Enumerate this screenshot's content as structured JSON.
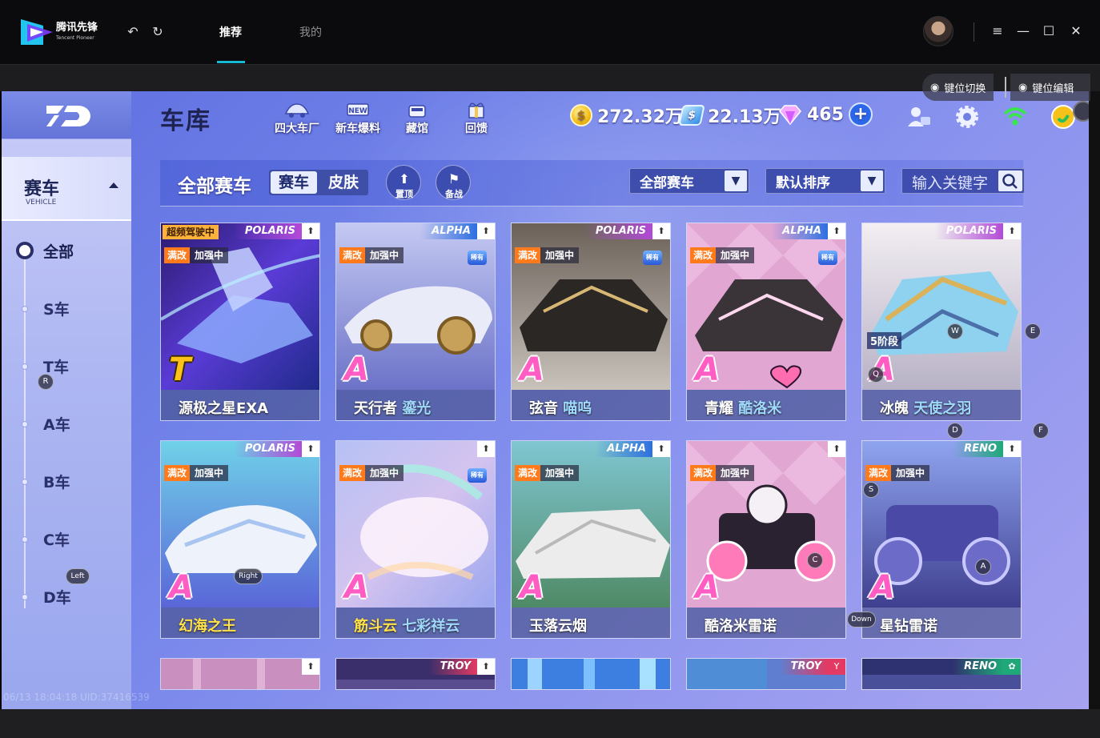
{
  "launcher": {
    "brand": "腾讯先锋",
    "brand_sub": "Tencent Pioneer",
    "tabs": [
      {
        "label": "推荐",
        "active": true
      },
      {
        "label": "我的",
        "active": false
      }
    ],
    "accent_color": "#17b8d6"
  },
  "overlay": {
    "key_switch": "键位切换",
    "key_edit": "键位编辑",
    "watermark": "06/13 18:04:18 UID:37416539",
    "keys": [
      "R",
      "E",
      "W",
      "Q",
      "D",
      "F",
      "S",
      "Right",
      "Left",
      "C",
      "A",
      "Down"
    ]
  },
  "game": {
    "title": "车库",
    "nav": [
      {
        "label": "四大车厂",
        "icon": "garage-car-icon"
      },
      {
        "label": "新车爆料",
        "icon": "new-badge-icon"
      },
      {
        "label": "藏馆",
        "icon": "museum-icon"
      },
      {
        "label": "回馈",
        "icon": "gift-icon"
      }
    ],
    "currency": {
      "coins": "272.32万",
      "vouchers": "22.13万",
      "diamonds": "465"
    },
    "sidebar": {
      "category": "赛车",
      "category_sub": "VEHICLE",
      "items": [
        "全部",
        "S车",
        "T车",
        "A车",
        "B车",
        "C车",
        "D车"
      ],
      "active_index": 0
    },
    "filter": {
      "title": "全部赛车",
      "segment": [
        "赛车",
        "皮肤"
      ],
      "pin_label": "置顶",
      "battle_label": "备战",
      "dropdown_type": "全部赛车",
      "dropdown_sort": "默认排序",
      "search_placeholder": "输入关键字"
    },
    "tags": {
      "maxed": "满改",
      "boosted": "加强中",
      "frequent": "超频驾驶中",
      "rare": "稀有"
    },
    "cards_row1": [
      {
        "series": "POLARIS",
        "name": "源极之星EXA",
        "skin": "",
        "grade": "T",
        "hot": true
      },
      {
        "series": "ALPHA",
        "name": "天行者",
        "skin": "鎏光",
        "grade": "A",
        "hot": false
      },
      {
        "series": "POLARIS",
        "name": "弦音",
        "skin": "喵呜",
        "grade": "A",
        "hot": false
      },
      {
        "series": "ALPHA",
        "name": "青耀",
        "skin": "酷洛米",
        "grade": "A",
        "hot": false
      },
      {
        "series": "POLARIS",
        "name": "冰魄",
        "skin": "天使之羽",
        "grade": "A",
        "hot": false,
        "stage": "5阶段"
      }
    ],
    "cards_row2": [
      {
        "series": "POLARIS",
        "name": "幻海之王",
        "skin": "",
        "grade": "A"
      },
      {
        "series": "",
        "name": "筋斗云",
        "skin": "七彩祥云",
        "grade": "A"
      },
      {
        "series": "ALPHA",
        "name": "玉落云烟",
        "skin": "",
        "grade": "A"
      },
      {
        "series": "",
        "name": "酷洛米雷诺",
        "skin": "",
        "grade": "A"
      },
      {
        "series": "RENO",
        "name": "星钻雷诺",
        "skin": "",
        "grade": "A"
      }
    ],
    "cards_row3": [
      {
        "series": ""
      },
      {
        "series": "TROY"
      },
      {
        "series": ""
      },
      {
        "series": "TROY"
      },
      {
        "series": "RENO"
      }
    ]
  }
}
